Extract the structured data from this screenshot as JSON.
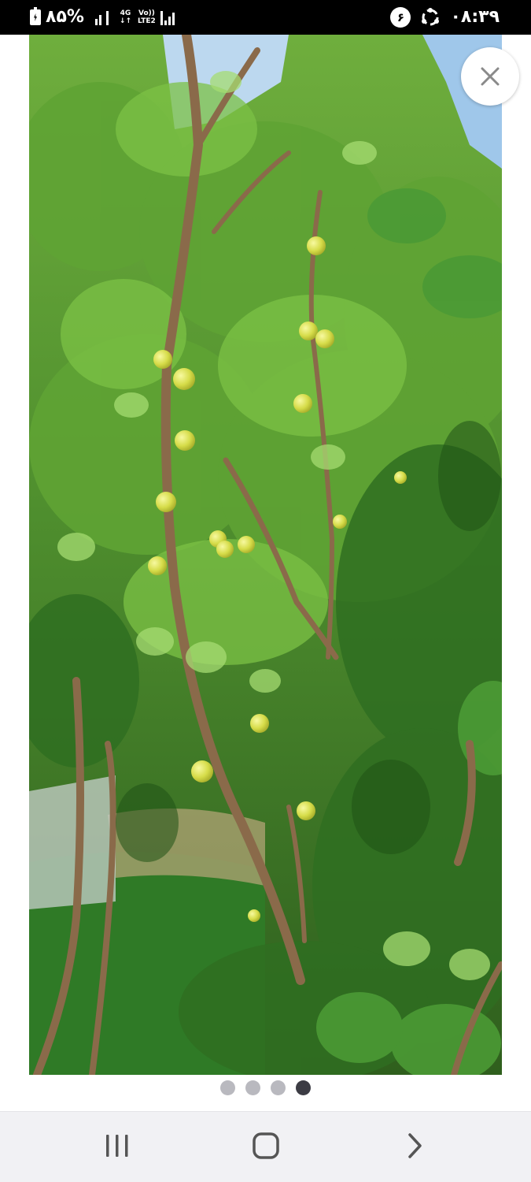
{
  "status_bar": {
    "battery_percent": "٨۵%",
    "network_type": "4G",
    "volte_label": "Vo))",
    "lte_label": "LTE2",
    "notification_count": "۶",
    "time": "٠٨:٣٩"
  },
  "photo_viewer": {
    "photo_icon": "fruit-tree-photo",
    "close_icon": "close-icon",
    "page_count": 4,
    "active_page": 4
  },
  "nav_bar": {
    "recents_icon": "recents-icon",
    "home_icon": "home-icon",
    "back_icon": "back-icon"
  },
  "colors": {
    "status_bar_bg": "#000000",
    "nav_bar_bg": "#f1f1f4",
    "dot_inactive": "#b9b9bf",
    "dot_active": "#3c3c44"
  }
}
